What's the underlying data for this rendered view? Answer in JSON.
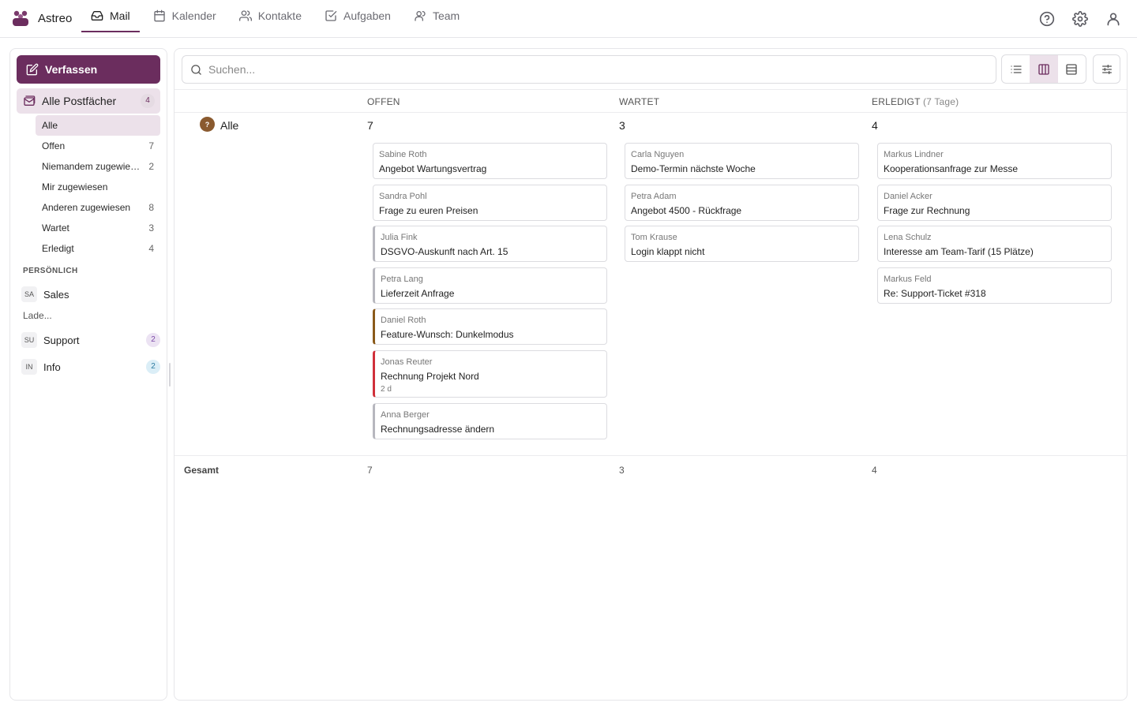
{
  "app": {
    "name": "Astreo",
    "brand_color": "#6b2d5e"
  },
  "nav": [
    {
      "label": "Mail",
      "icon": "inbox-icon",
      "active": true
    },
    {
      "label": "Kalender",
      "icon": "calendar-icon",
      "active": false
    },
    {
      "label": "Kontakte",
      "icon": "contacts-icon",
      "active": false
    },
    {
      "label": "Aufgaben",
      "icon": "checkbox-icon",
      "active": false
    },
    {
      "label": "Team",
      "icon": "team-icon",
      "active": false
    }
  ],
  "top_icons": [
    "help-icon",
    "gear-icon",
    "user-icon"
  ],
  "sidebar": {
    "compose_label": "Verfassen",
    "all_mailboxes": {
      "label": "Alle Postfächer",
      "count": "4"
    },
    "filters": [
      {
        "label": "Alle",
        "count": "",
        "active": true
      },
      {
        "label": "Offen",
        "count": "7"
      },
      {
        "label": "Niemandem zugewiesen",
        "count": "2"
      },
      {
        "label": "Mir zugewiesen",
        "count": ""
      },
      {
        "label": "Anderen zugewiesen",
        "count": "8"
      },
      {
        "label": "Wartet",
        "count": "3"
      },
      {
        "label": "Erledigt",
        "count": "4"
      }
    ],
    "personal_label": "PERSÖNLICH",
    "mailboxes": [
      {
        "abbr": "SA",
        "name": "Sales",
        "count": ""
      },
      {
        "abbr": "SU",
        "name": "Support",
        "count": "2",
        "badge_color": "#7b4aa8"
      },
      {
        "abbr": "IN",
        "name": "Info",
        "count": "2",
        "badge_color": "#2c7aa0"
      }
    ],
    "loading_text": "Lade..."
  },
  "search": {
    "placeholder": "Suchen..."
  },
  "view_modes": [
    {
      "icon": "list-icon",
      "active": false
    },
    {
      "icon": "columns-icon",
      "active": true
    },
    {
      "icon": "rows-icon",
      "active": false
    }
  ],
  "filter_icon": "sliders-icon",
  "board": {
    "columns": [
      {
        "title": "OFFEN",
        "extra": "",
        "count": "7",
        "total": "7"
      },
      {
        "title": "WARTET",
        "extra": "",
        "count": "3",
        "total": "3"
      },
      {
        "title": "ERLEDIGT",
        "extra": "(7 Tage)",
        "count": "4",
        "total": "4"
      }
    ],
    "group": {
      "avatar": "?",
      "name": "Alle"
    },
    "total_label": "Gesamt",
    "cards": {
      "offen": [
        {
          "from": "Sabine Roth",
          "subject": "Angebot Wartungsvertrag",
          "age": "",
          "accent": ""
        },
        {
          "from": "Sandra Pohl",
          "subject": "Frage zu euren Preisen",
          "age": "",
          "accent": ""
        },
        {
          "from": "Julia Fink",
          "subject": "DSGVO-Auskunft nach Art. 15",
          "age": "",
          "accent": "#b7b7be"
        },
        {
          "from": "Petra Lang",
          "subject": "Lieferzeit Anfrage",
          "age": "",
          "accent": "#b7b7be"
        },
        {
          "from": "Daniel Roth",
          "subject": "Feature-Wunsch: Dunkelmodus",
          "age": "",
          "accent": "#8a5a1a"
        },
        {
          "from": "Jonas Reuter",
          "subject": "Rechnung Projekt Nord",
          "age": "2 d",
          "accent": "#d0303a"
        },
        {
          "from": "Anna Berger",
          "subject": "Rechnungsadresse ändern",
          "age": "",
          "accent": "#b7b7be"
        }
      ],
      "wartet": [
        {
          "from": "Carla Nguyen",
          "subject": "Demo-Termin nächste Woche"
        },
        {
          "from": "Petra Adam",
          "subject": "Angebot 4500 - Rückfrage"
        },
        {
          "from": "Tom Krause",
          "subject": "Login klappt nicht"
        }
      ],
      "erledigt": [
        {
          "from": "Markus Lindner",
          "subject": "Kooperationsanfrage zur Messe"
        },
        {
          "from": "Daniel Acker",
          "subject": "Frage zur Rechnung"
        },
        {
          "from": "Lena Schulz",
          "subject": "Interesse am Team-Tarif (15 Plätze)"
        },
        {
          "from": "Markus Feld",
          "subject": "Re: Support-Ticket #318"
        }
      ]
    }
  }
}
